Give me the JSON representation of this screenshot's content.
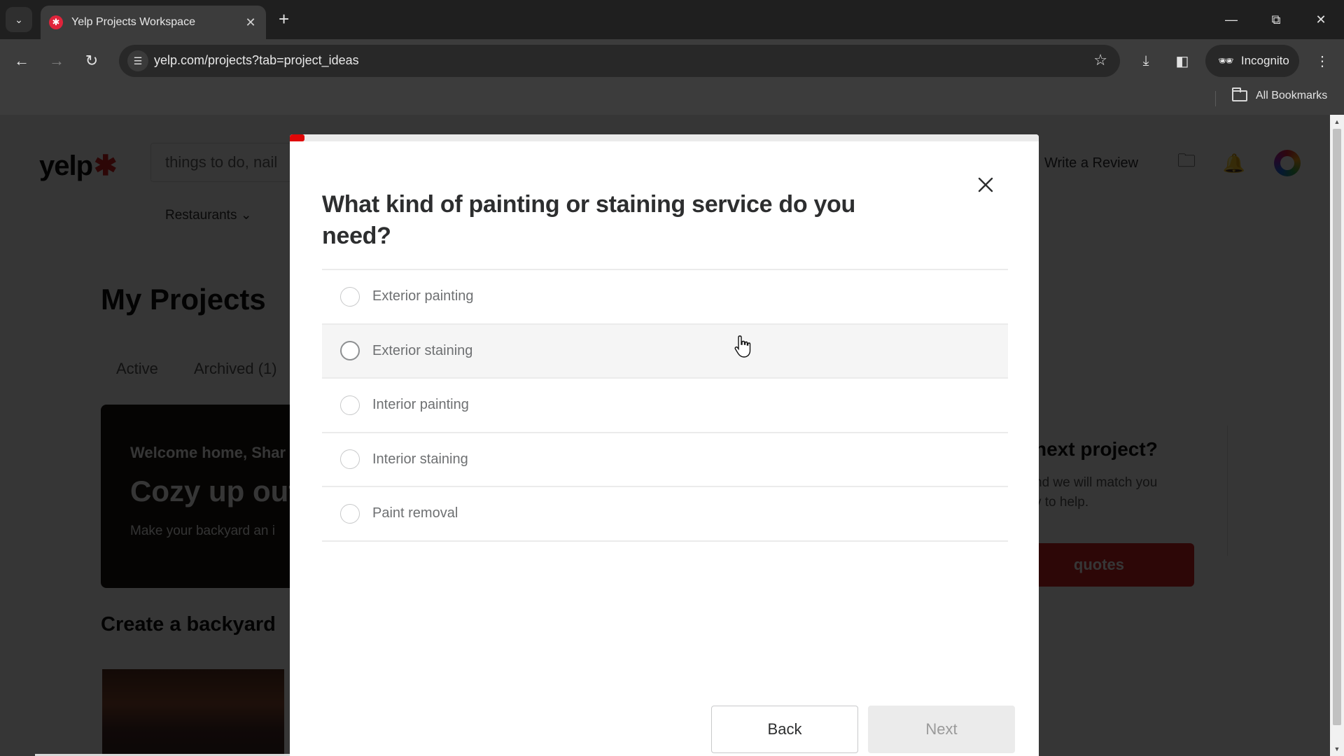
{
  "browser": {
    "tab_title": "Yelp Projects Workspace",
    "url": "yelp.com/projects?tab=project_ideas",
    "incognito_label": "Incognito",
    "all_bookmarks_label": "All Bookmarks"
  },
  "page": {
    "search_placeholder": "things to do, nail",
    "nav_category": "Restaurants",
    "write_review": "Write a Review",
    "title": "My Projects",
    "tabs": [
      {
        "label": "Active"
      },
      {
        "label": "Archived (1)"
      }
    ],
    "hero": {
      "greeting": "Welcome home, Shar",
      "headline": "Cozy up out",
      "subtext": "Make your backyard an i"
    },
    "section_title": "Create a backyard",
    "side_card": {
      "title": "next project?",
      "text": "nd we will match you\ny to help.",
      "button": "quotes"
    }
  },
  "modal": {
    "progress_percent": 2,
    "question": "What kind of painting or staining service do you need?",
    "options": [
      {
        "label": "Exterior painting",
        "selected": false
      },
      {
        "label": "Exterior staining",
        "selected": false
      },
      {
        "label": "Interior painting",
        "selected": false
      },
      {
        "label": "Interior staining",
        "selected": false
      },
      {
        "label": "Paint removal",
        "selected": false
      }
    ],
    "hovered_option_index": 1,
    "back_label": "Back",
    "next_label": "Next",
    "next_enabled": false
  },
  "colors": {
    "brand_red": "#d32323",
    "progress_red": "#e00707"
  }
}
